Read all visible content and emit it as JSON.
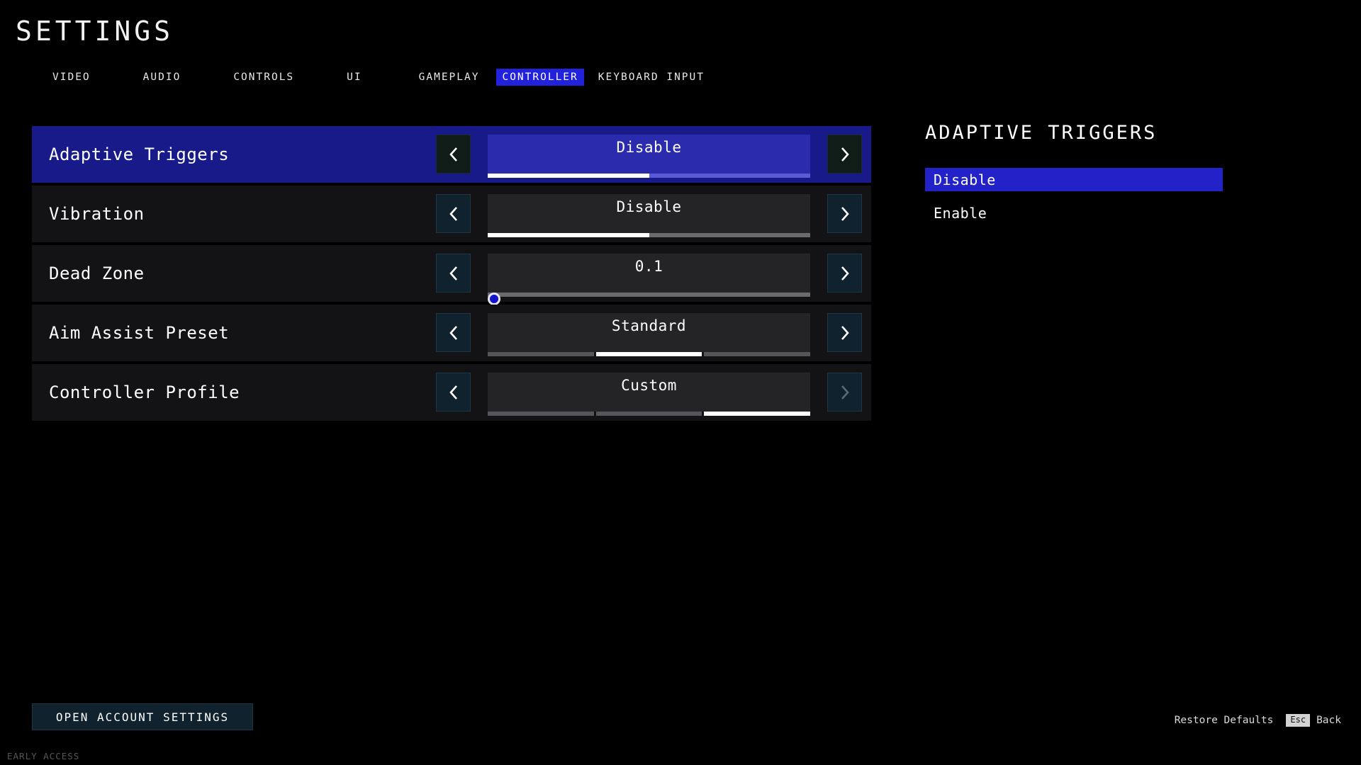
{
  "header": {
    "title": "SETTINGS",
    "tabs": [
      {
        "label": "VIDEO",
        "active": false
      },
      {
        "label": "AUDIO",
        "active": false
      },
      {
        "label": "CONTROLS",
        "active": false
      },
      {
        "label": "UI",
        "active": false
      },
      {
        "label": "GAMEPLAY",
        "active": false
      },
      {
        "label": "CONTROLLER",
        "active": true
      },
      {
        "label": "KEYBOARD INPUT",
        "active": false
      }
    ]
  },
  "settings": {
    "rows": [
      {
        "label": "Adaptive Triggers",
        "value": "Disable",
        "selected": true,
        "left_arrow": "‹",
        "right_arrow": "›",
        "left_enabled": true,
        "right_enabled": true,
        "bar_type": "fill",
        "fill_percent": 50
      },
      {
        "label": "Vibration",
        "value": "Disable",
        "selected": false,
        "left_arrow": "‹",
        "right_arrow": "›",
        "left_enabled": true,
        "right_enabled": true,
        "bar_type": "fill",
        "fill_percent": 50
      },
      {
        "label": "Dead Zone",
        "value": "0.1",
        "selected": false,
        "left_arrow": "‹",
        "right_arrow": "›",
        "left_enabled": true,
        "right_enabled": true,
        "bar_type": "knob",
        "knob_percent": 2
      },
      {
        "label": "Aim Assist Preset",
        "value": "Standard",
        "selected": false,
        "left_arrow": "‹",
        "right_arrow": "›",
        "left_enabled": true,
        "right_enabled": true,
        "bar_type": "segments",
        "segments": 3,
        "segment_active": 1
      },
      {
        "label": "Controller Profile",
        "value": "Custom",
        "selected": false,
        "left_arrow": "‹",
        "right_arrow": "›",
        "left_enabled": true,
        "right_enabled": false,
        "bar_type": "segments",
        "segments": 3,
        "segment_active": 2
      }
    ]
  },
  "detail": {
    "title": "ADAPTIVE TRIGGERS",
    "options": [
      {
        "label": "Disable",
        "selected": true
      },
      {
        "label": "Enable",
        "selected": false
      }
    ]
  },
  "footer": {
    "account_button": "OPEN ACCOUNT SETTINGS",
    "restore_defaults": "Restore Defaults",
    "back_key": "Esc",
    "back_label": "Back",
    "early_access": "EARLY ACCESS"
  },
  "colors": {
    "accent_blue": "#2222dd",
    "row_selected": "#181a8a",
    "row_bg": "#131316",
    "arrow_bg": "#10222e",
    "background": "#000000"
  }
}
